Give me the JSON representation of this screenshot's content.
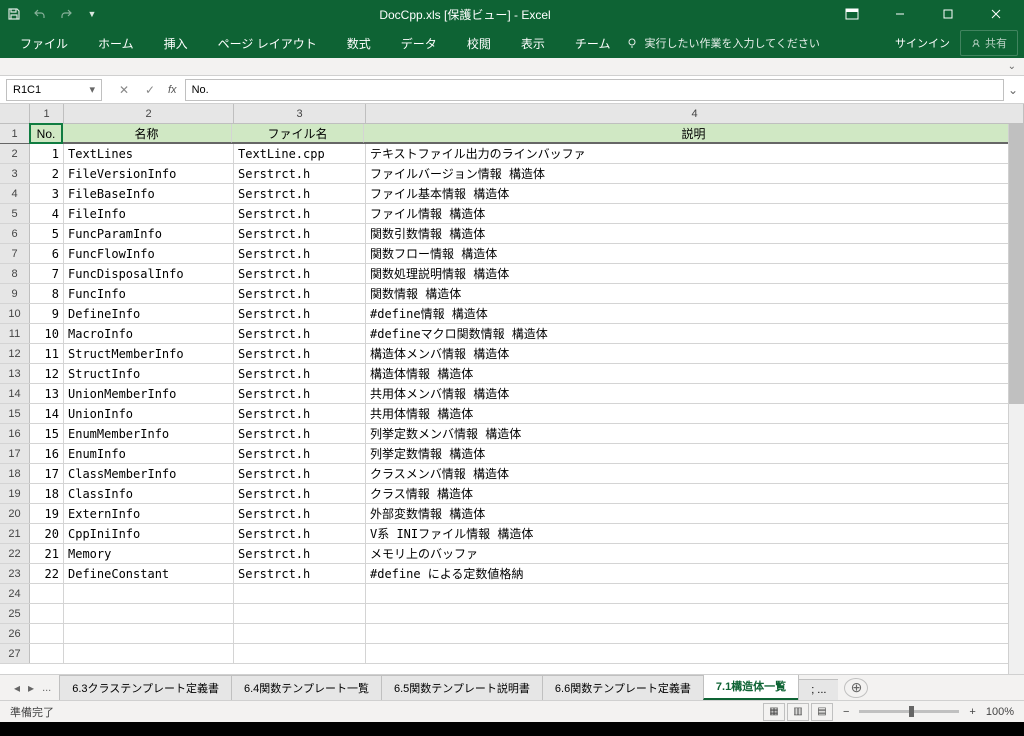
{
  "titlebar": {
    "title": "DocCpp.xls [保護ビュー] - Excel"
  },
  "ribbon": {
    "tabs": [
      "ファイル",
      "ホーム",
      "挿入",
      "ページ レイアウト",
      "数式",
      "データ",
      "校閲",
      "表示",
      "チーム"
    ],
    "search_hint": "実行したい作業を入力してください",
    "signin": "サインイン",
    "share": "共有"
  },
  "namebox": "R1C1",
  "formula": "No.",
  "col_labels": [
    "1",
    "2",
    "3",
    "4"
  ],
  "headers": {
    "c1": "No.",
    "c2": "名称",
    "c3": "ファイル名",
    "c4": "説明"
  },
  "rows": [
    {
      "n": "1",
      "name": "TextLines",
      "file": "TextLine.cpp",
      "desc": "テキストファイル出力のラインバッファ"
    },
    {
      "n": "2",
      "name": "FileVersionInfo",
      "file": "Serstrct.h",
      "desc": "ファイルバージョン情報 構造体"
    },
    {
      "n": "3",
      "name": "FileBaseInfo",
      "file": "Serstrct.h",
      "desc": "ファイル基本情報 構造体"
    },
    {
      "n": "4",
      "name": "FileInfo",
      "file": "Serstrct.h",
      "desc": "ファイル情報 構造体"
    },
    {
      "n": "5",
      "name": "FuncParamInfo",
      "file": "Serstrct.h",
      "desc": "関数引数情報 構造体"
    },
    {
      "n": "6",
      "name": "FuncFlowInfo",
      "file": "Serstrct.h",
      "desc": "関数フロー情報 構造体"
    },
    {
      "n": "7",
      "name": "FuncDisposalInfo",
      "file": "Serstrct.h",
      "desc": "関数処理説明情報 構造体"
    },
    {
      "n": "8",
      "name": "FuncInfo",
      "file": "Serstrct.h",
      "desc": "関数情報 構造体"
    },
    {
      "n": "9",
      "name": "DefineInfo",
      "file": "Serstrct.h",
      "desc": "#define情報 構造体"
    },
    {
      "n": "10",
      "name": "MacroInfo",
      "file": "Serstrct.h",
      "desc": "#defineマクロ関数情報 構造体"
    },
    {
      "n": "11",
      "name": "StructMemberInfo",
      "file": "Serstrct.h",
      "desc": "構造体メンバ情報 構造体"
    },
    {
      "n": "12",
      "name": "StructInfo",
      "file": "Serstrct.h",
      "desc": "構造体情報 構造体"
    },
    {
      "n": "13",
      "name": "UnionMemberInfo",
      "file": "Serstrct.h",
      "desc": "共用体メンバ情報 構造体"
    },
    {
      "n": "14",
      "name": "UnionInfo",
      "file": "Serstrct.h",
      "desc": "共用体情報 構造体"
    },
    {
      "n": "15",
      "name": "EnumMemberInfo",
      "file": "Serstrct.h",
      "desc": "列挙定数メンバ情報 構造体"
    },
    {
      "n": "16",
      "name": "EnumInfo",
      "file": "Serstrct.h",
      "desc": "列挙定数情報 構造体"
    },
    {
      "n": "17",
      "name": "ClassMemberInfo",
      "file": "Serstrct.h",
      "desc": "クラスメンバ情報 構造体"
    },
    {
      "n": "18",
      "name": "ClassInfo",
      "file": "Serstrct.h",
      "desc": "クラス情報 構造体"
    },
    {
      "n": "19",
      "name": "ExternInfo",
      "file": "Serstrct.h",
      "desc": "外部変数情報 構造体"
    },
    {
      "n": "20",
      "name": "CppIniInfo",
      "file": "Serstrct.h",
      "desc": "V系 INIファイル情報 構造体"
    },
    {
      "n": "21",
      "name": "Memory",
      "file": "Serstrct.h",
      "desc": "メモリ上のバッファ"
    },
    {
      "n": "22",
      "name": "DefineConstant",
      "file": "Serstrct.h",
      "desc": "#define による定数値格納"
    }
  ],
  "empty_rows": [
    "24",
    "25",
    "26",
    "27"
  ],
  "sheets": {
    "ellipsis_left": "...",
    "tabs": [
      "6.3クラステンプレート定義書",
      "6.4関数テンプレート一覧",
      "6.5関数テンプレート説明書",
      "6.6関数テンプレート定義書"
    ],
    "active": "7.1構造体一覧",
    "ellipsis_right": "; ..."
  },
  "status": {
    "ready": "準備完了",
    "zoom": "100%"
  }
}
